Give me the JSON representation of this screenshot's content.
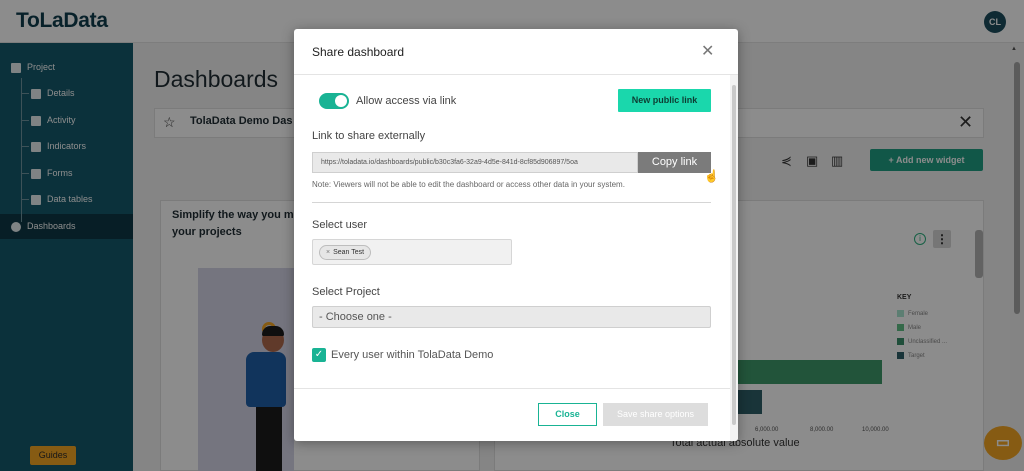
{
  "app": {
    "logo": "ToLaData",
    "avatar": "CL"
  },
  "sidebar": {
    "items": [
      {
        "label": "Project",
        "icon": "project-icon"
      },
      {
        "label": "Details",
        "icon": "details-icon"
      },
      {
        "label": "Activity",
        "icon": "activity-icon"
      },
      {
        "label": "Indicators",
        "icon": "indicators-icon"
      },
      {
        "label": "Forms",
        "icon": "forms-icon"
      },
      {
        "label": "Data tables",
        "icon": "data-tables-icon"
      },
      {
        "label": "Dashboards",
        "icon": "dashboards-icon"
      }
    ],
    "guides_label": "Guides"
  },
  "page": {
    "title": "Dashboards",
    "dashboard_name": "TolaData Demo Das",
    "add_widget_label": "+ Add new widget",
    "card_title": "Simplify the way you m your projects",
    "chart_key_title": "KEY",
    "chart_key": [
      {
        "label": "Female",
        "color": "#a8e6cf"
      },
      {
        "label": "Male",
        "color": "#5fbf86"
      },
      {
        "label": "Unclassified ...",
        "color": "#3a8f6a"
      },
      {
        "label": "Target",
        "color": "#2e5f68"
      }
    ],
    "chart_ticks": [
      "6,000.00",
      "8,000.00",
      "10,000.00"
    ],
    "chart_xlabel": "Total actual absolute value"
  },
  "modal": {
    "title": "Share dashboard",
    "toggle_label": "Allow access via link",
    "toggle_on": true,
    "new_public_link_label": "New public link",
    "link_section_label": "Link to share externally",
    "link_value": "https://toladata.io/dashboards/public/b30c3fa6-32a9-4d5e-841d-8cf85d906897/5oa",
    "copy_link_label": "Copy link",
    "note": "Note: Viewers will not be able to edit the dashboard or access other data in your system.",
    "select_user_label": "Select user",
    "selected_user": "Sean Test",
    "select_project_label": "Select Project",
    "project_placeholder": "- Choose one -",
    "every_user_label": "Every user within TolaData Demo",
    "every_user_checked": true,
    "close_label": "Close",
    "save_label": "Save share options"
  },
  "colors": {
    "accent": "#19b394",
    "sidebar": "#145a6c",
    "new_link_button": "#1ad7ac",
    "guides": "#f5a623"
  }
}
